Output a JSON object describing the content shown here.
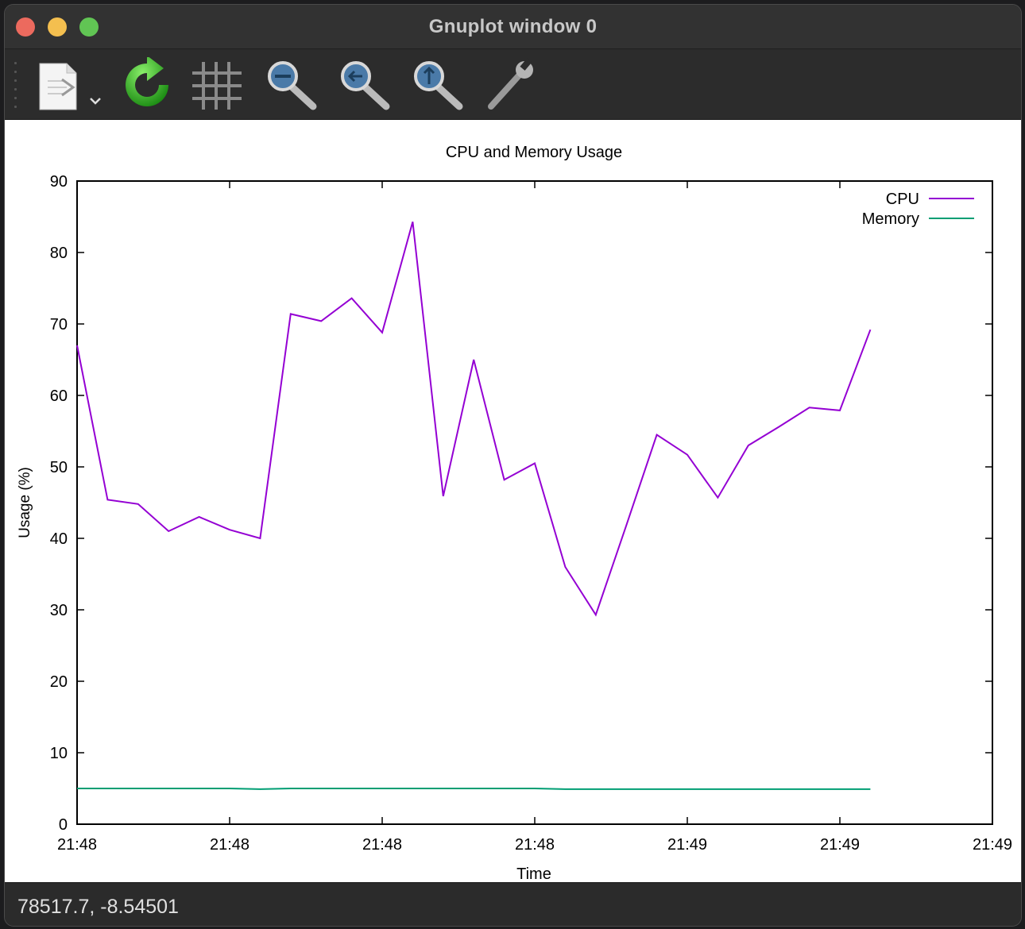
{
  "window": {
    "title": "Gnuplot window 0"
  },
  "toolbar": {
    "items": [
      {
        "name": "export-button",
        "icon": "document-export-icon"
      },
      {
        "name": "replot-button",
        "icon": "refresh-icon"
      },
      {
        "name": "grid-button",
        "icon": "grid-icon"
      },
      {
        "name": "zoom-out-button",
        "icon": "zoom-out-icon"
      },
      {
        "name": "zoom-prev-button",
        "icon": "zoom-previous-icon"
      },
      {
        "name": "zoom-next-button",
        "icon": "zoom-next-icon"
      },
      {
        "name": "settings-button",
        "icon": "wrench-icon"
      }
    ]
  },
  "status": {
    "coords": "78517.7, -8.54501"
  },
  "chart_data": {
    "type": "line",
    "title": "CPU and Memory Usage",
    "xlabel": "Time",
    "ylabel": "Usage (%)",
    "x_tick_labels": [
      "21:48",
      "21:48",
      "21:48",
      "21:48",
      "21:49",
      "21:49",
      "21:49"
    ],
    "y_ticks": [
      "0",
      "10",
      "20",
      "30",
      "40",
      "50",
      "60",
      "70",
      "80",
      "90"
    ],
    "ylim": [
      0,
      90
    ],
    "xlim": [
      0,
      60
    ],
    "legend_position": "top-right",
    "grid": false,
    "series": [
      {
        "name": "CPU",
        "color": "#9400d3",
        "x": [
          0,
          2,
          4,
          6,
          8,
          10,
          12,
          14,
          16,
          18,
          20,
          22,
          24,
          26,
          28,
          30,
          32,
          34,
          36,
          38,
          40,
          42,
          44,
          46,
          48,
          50,
          52
        ],
        "values": [
          67,
          45.4,
          44.8,
          41,
          43,
          41.2,
          40,
          71.4,
          70.4,
          73.6,
          68.8,
          84.3,
          45.9,
          65,
          48.2,
          50.5,
          36,
          29.3,
          41.8,
          54.5,
          51.7,
          45.7,
          53,
          55.6,
          58.3,
          57.9,
          69.2
        ]
      },
      {
        "name": "Memory",
        "color": "#009e73",
        "x": [
          0,
          2,
          4,
          6,
          8,
          10,
          12,
          14,
          16,
          18,
          20,
          22,
          24,
          26,
          28,
          30,
          32,
          34,
          36,
          38,
          40,
          42,
          44,
          46,
          48,
          50,
          52
        ],
        "values": [
          5.0,
          5.0,
          5.0,
          5.0,
          5.0,
          5.0,
          4.9,
          5.0,
          5.0,
          5.0,
          5.0,
          5.0,
          5.0,
          5.0,
          5.0,
          5.0,
          4.9,
          4.9,
          4.9,
          4.9,
          4.9,
          4.9,
          4.9,
          4.9,
          4.9,
          4.9,
          4.9
        ]
      }
    ]
  }
}
